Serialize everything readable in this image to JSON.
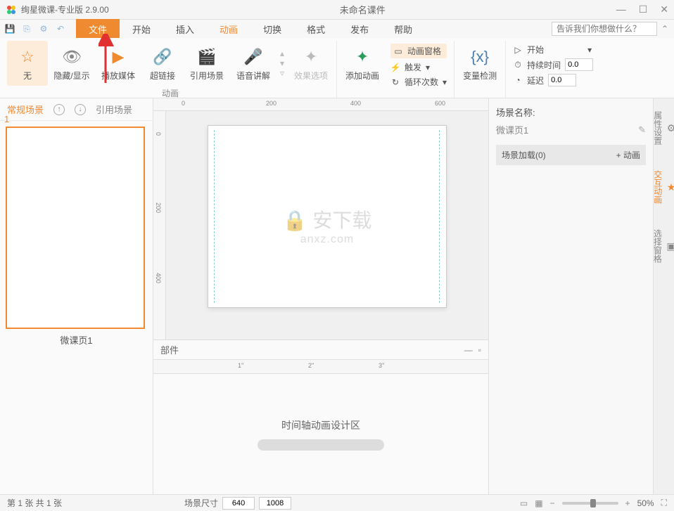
{
  "titlebar": {
    "app_title": "绚星微课-专业版 2.9.00",
    "doc_title": "未命名课件"
  },
  "qat": {
    "tooltips": [
      "save",
      "new",
      "settings",
      "undo"
    ]
  },
  "tabs": {
    "file": "文件",
    "start": "开始",
    "insert": "插入",
    "animation": "动画",
    "transition": "切换",
    "format": "格式",
    "publish": "发布",
    "help": "帮助"
  },
  "tellme": {
    "placeholder": "告诉我们你想做什么？"
  },
  "ribbon": {
    "none": "无",
    "hideshow": "隐藏/显示",
    "playmedia": "播放媒体",
    "hyperlink": "超链接",
    "refscene": "引用场景",
    "voice": "语音讲解",
    "effectopts": "效果选项",
    "addanim": "添加动画",
    "animpane": "动画窗格",
    "trigger": "触发",
    "loopcount": "循环次数",
    "vardetect": "变量检测",
    "start_label": "开始",
    "duration": "持续时间",
    "delay": "延迟",
    "duration_val": "0.0",
    "delay_val": "0.0",
    "group_animation": "动画"
  },
  "left": {
    "tab_normal": "常规场景",
    "tab_ref": "引用场景",
    "slide_num": "1",
    "slide_label": "微课页1"
  },
  "ruler_h": {
    "m0": "0",
    "m1": "200",
    "m2": "400",
    "m3": "600"
  },
  "ruler_v": {
    "m0": "0",
    "m1": "200",
    "m2": "400"
  },
  "timeline": {
    "label": "部件",
    "placeholder": "时间轴动画设计区",
    "m1": "1''",
    "m2": "2''",
    "m3": "3''"
  },
  "right": {
    "scene_name_label": "场景名称:",
    "scene_name_value": "微课页1",
    "scene_load": "场景加载(0)",
    "add_anim": "+ 动画",
    "tab_props": "属性设置",
    "tab_interact": "交互动画",
    "tab_select": "选择窗格"
  },
  "statusbar": {
    "page_info": "第 1 张  共 1 张",
    "scene_size_label": "场景尺寸",
    "w": "640",
    "h": "1008",
    "zoom": "50%"
  },
  "watermark": {
    "main": "安下载",
    "sub": "anxz.com"
  }
}
